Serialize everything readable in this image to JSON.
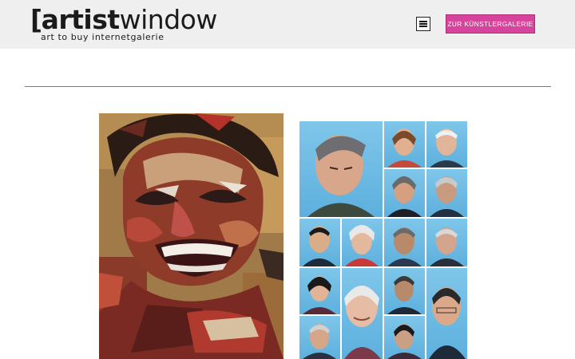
{
  "header": {
    "logo": {
      "bracket": "[",
      "bold": "artist",
      "light": "window",
      "tagline": "art to buy internetgalerie"
    },
    "menu_icon": "hamburger-icon",
    "cta_label": "ZUR KÜNSTLERGALERIE"
  },
  "colors": {
    "header_bg": "#efefef",
    "cta": "#d6449b",
    "divider": "#7a7a7a"
  },
  "gallery": {
    "images": [
      {
        "kind": "painting",
        "subject": "smiling child portrait"
      },
      {
        "kind": "painting-collage",
        "subject": "grid of portrait heads",
        "tiles": 18
      }
    ]
  }
}
